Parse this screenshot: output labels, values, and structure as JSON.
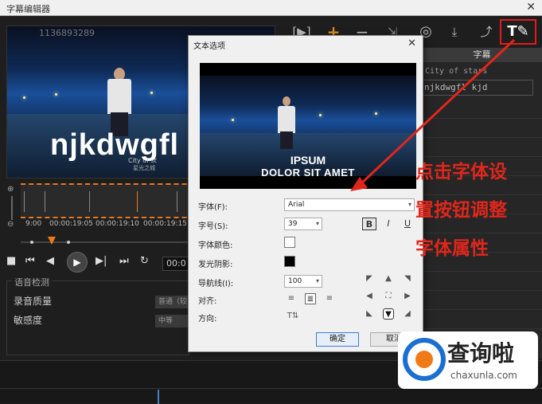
{
  "window": {
    "title": "字幕编辑器",
    "close": "✕"
  },
  "preview": {
    "watermark": "1136893289",
    "subtitle_big": "njkdwgfl",
    "subtitle_small1": "City of st",
    "subtitle_small2": "星光之城"
  },
  "toolbar": {
    "icons": [
      "import-icon",
      "add-icon",
      "remove-icon",
      "export-disabled-icon",
      "voice-detect-icon",
      "import-subtitle-icon",
      "export-subtitle-icon",
      "font-settings-icon"
    ],
    "import_glyph": "[▶]",
    "add_glyph": "+",
    "remove_glyph": "−",
    "export_disabled_glyph": "⇲",
    "voice_glyph": "◎",
    "import_subtitle_glyph": "⤓",
    "export_subtitle_glyph": "⤴",
    "font_glyph": "T✎"
  },
  "subtitle_panel": {
    "header": "字幕",
    "row1": "City of stars",
    "row2": "njkdwgfl kjd"
  },
  "timeline": {
    "ticks": [
      "9:00",
      "00:00:19:05",
      "00:00:19:10",
      "00:00:19:15"
    ]
  },
  "transport": {
    "stop": "■",
    "prev": "⏮",
    "back": "◀",
    "play": "▶",
    "forward": "▶|",
    "next": "⏭",
    "loop": "↻",
    "time": "00:0"
  },
  "speech": {
    "legend": "语音检测",
    "quality_label": "录音质量",
    "quality_value": "普通（较",
    "sensitivity_label": "敏感度",
    "sensitivity_value": "中等"
  },
  "dialog": {
    "title": "文本选项",
    "close": "✕",
    "preview_line1": "IPSUM",
    "preview_line2": "DOLOR SIT AMET",
    "font_label": "字体(F):",
    "font_value": "Arial",
    "size_label": "字号(S):",
    "size_value": "39",
    "bold": "B",
    "italic": "I",
    "underline": "U",
    "font_color_label": "字体颜色:",
    "font_color": "#ffffff",
    "shadow_label": "发光阴影:",
    "shadow_color": "#000000",
    "guide_label": "导航线(I):",
    "guide_value": "100",
    "align_label": "对齐:",
    "direction_label": "方向:",
    "direction_glyph": "T⇅",
    "ok": "确定",
    "cancel": "取消"
  },
  "annotation": {
    "line1": "点击字体设",
    "line2": "置按钮调整",
    "line3": "字体属性",
    "color": "#e0261c"
  },
  "logo": {
    "brand": "查询啦",
    "url": "chaxunla.com"
  }
}
